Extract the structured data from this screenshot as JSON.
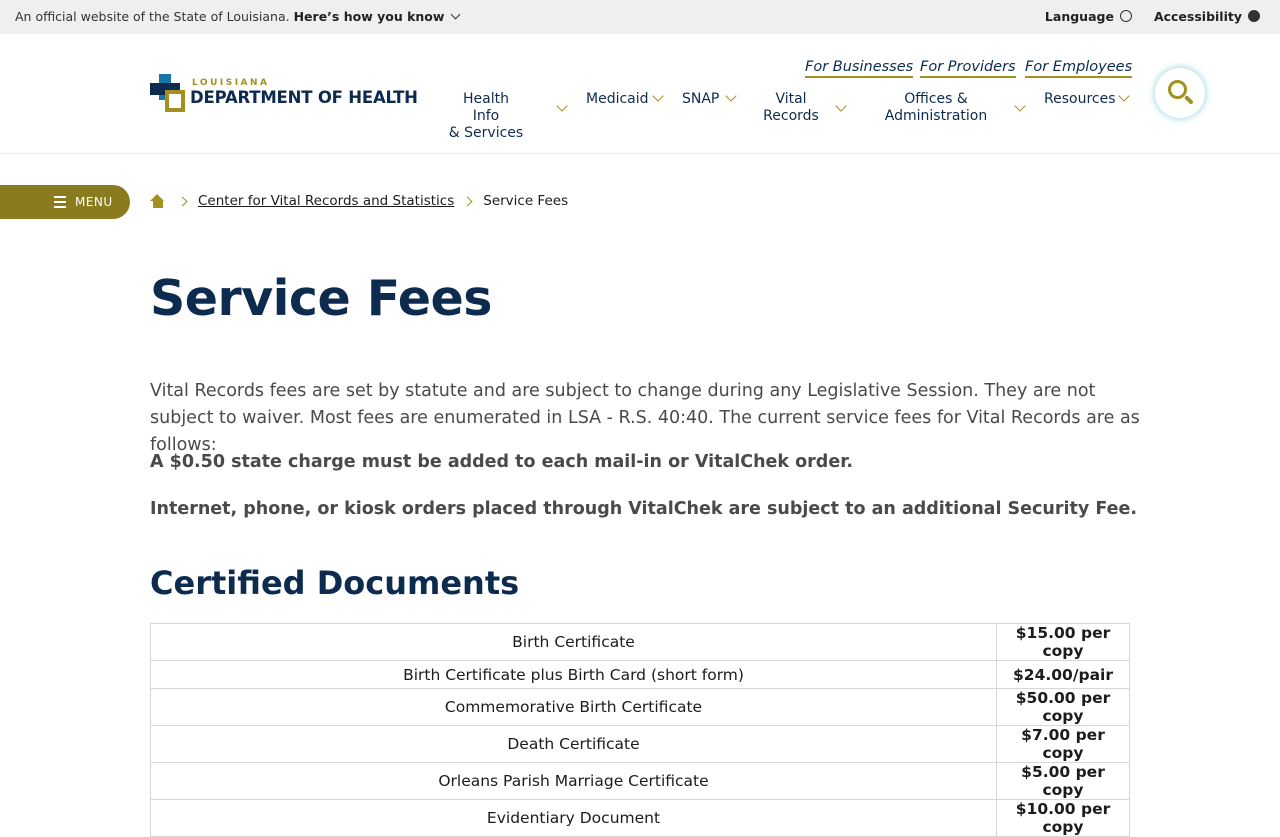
{
  "official_bar": {
    "text": "An official website of the State of Louisiana.",
    "link": "Here’s how you know",
    "language": "Language",
    "accessibility": "Accessibility"
  },
  "logo": {
    "top": "LOUISIANA",
    "main": "DEPARTMENT OF HEALTH"
  },
  "utility_links": [
    "For Businesses",
    "For Providers",
    "For Employees"
  ],
  "nav": {
    "health_1": "Health Info",
    "health_2": "& Services",
    "medicaid": "Medicaid",
    "snap": "SNAP",
    "vital_1": "Vital",
    "vital_2": "Records",
    "offices_1": "Offices &",
    "offices_2": "Administration",
    "resources": "Resources"
  },
  "menu_label": "MENU",
  "breadcrumb": {
    "parent": "Center for Vital Records and Statistics",
    "current": "Service Fees"
  },
  "page": {
    "title": "Service Fees",
    "intro": "Vital Records fees are set by statute and are subject to change during any Legislative Session. They are not subject to waiver. Most fees are enumerated in LSA - R.S. 40:40. The current service fees for Vital Records are as follows:",
    "note1": "A $0.50 state charge must be added to each mail-in or VitalChek order.",
    "note2": "Internet, phone, or kiosk orders placed through VitalChek are subject to an additional Security Fee.",
    "section_title": "Certified Documents"
  },
  "fees": [
    {
      "doc": "Birth Certificate",
      "price": "$15.00 per copy"
    },
    {
      "doc": "Birth Certificate plus Birth Card (short form)",
      "price": "$24.00/pair"
    },
    {
      "doc": "Commemorative Birth Certificate",
      "price": "$50.00 per copy"
    },
    {
      "doc": "Death Certificate",
      "price": "$7.00 per copy"
    },
    {
      "doc": "Orleans Parish Marriage Certificate",
      "price": "$5.00 per copy"
    },
    {
      "doc": "Evidentiary Document",
      "price": "$10.00 per copy"
    }
  ],
  "colors": {
    "navy": "#0d2b4f",
    "gold": "#a3901e",
    "menu": "#8a7b1f",
    "table_border": "#5aaed3"
  }
}
